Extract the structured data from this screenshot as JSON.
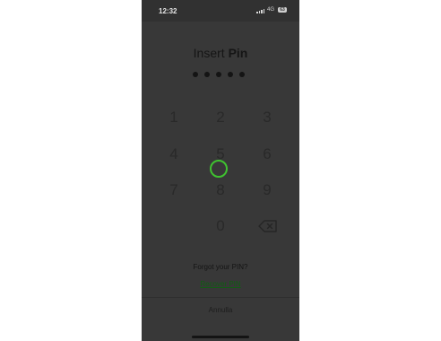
{
  "status_bar": {
    "time": "12:32",
    "network": "4G",
    "battery": "63"
  },
  "pin": {
    "title_prefix": "Insert",
    "title_bold": "Pin",
    "entered_digits": 5
  },
  "keypad": {
    "keys": [
      "1",
      "2",
      "3",
      "4",
      "5",
      "6",
      "7",
      "8",
      "9",
      "0"
    ],
    "backspace_icon": "backspace-icon"
  },
  "links": {
    "forgot": "Forgot your PIN?",
    "recover": "Recover PIN",
    "cancel": "Annulla"
  },
  "colors": {
    "screen": "#383838",
    "accent_ring": "#3fc230",
    "link": "#0f5f12"
  }
}
